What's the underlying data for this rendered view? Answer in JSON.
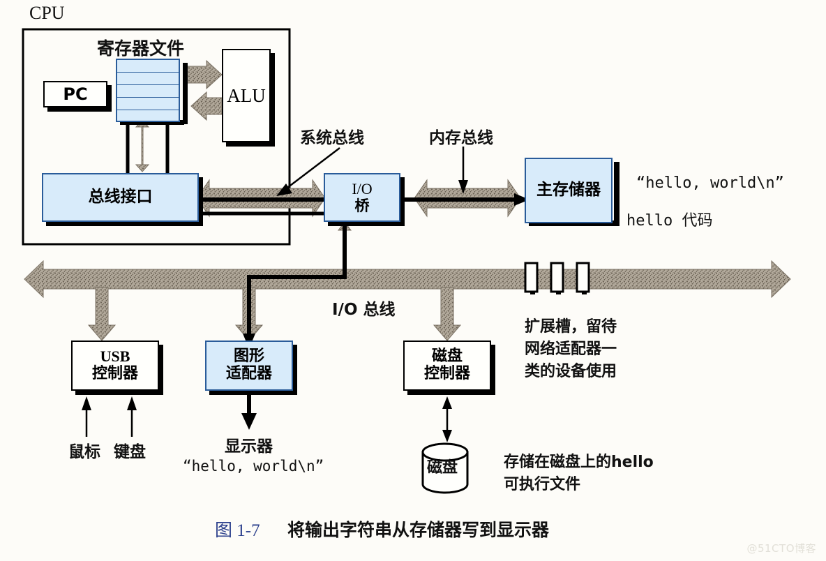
{
  "figure": {
    "cpu_label": "CPU",
    "caption_number": "图 1-7",
    "caption_text": "将输出字符串从存储器写到显示器",
    "watermark": "@51CTO博客"
  },
  "cpu": {
    "pc": "PC",
    "register_file_title": "寄存器文件",
    "alu": "ALU",
    "bus_interface": "总线接口"
  },
  "buses": {
    "system_bus": "系统总线",
    "memory_bus": "内存总线",
    "io_bus": "I/O 总线"
  },
  "bridge": {
    "line1": "I/O",
    "line2": "桥"
  },
  "memory": {
    "box": "主存储器",
    "contents_line1": "“hello, world\\n”",
    "contents_line2": "hello 代码"
  },
  "devices": [
    {
      "name": "usb-controller",
      "line1": "USB",
      "line2": "控制器",
      "style": "white"
    },
    {
      "name": "graphics-adapter",
      "line1": "图形",
      "line2": "适配器",
      "style": "blue"
    },
    {
      "name": "disk-controller",
      "line1": "磁盘",
      "line2": "控制器",
      "style": "white"
    }
  ],
  "peripherals": {
    "mouse": "鼠标",
    "keyboard": "键盘",
    "display": "显示器",
    "display_output": "“hello, world\\n”",
    "disk": "磁盘"
  },
  "notes": {
    "expansion_slots": [
      "扩展槽，留待",
      "网络适配器一",
      "类的设备使用"
    ],
    "disk_file": [
      "存储在磁盘上的hello",
      "可执行文件"
    ]
  },
  "colors": {
    "blue_fill": "#d8ebfa",
    "blue_stroke": "#2a5c9a",
    "bus_gray": "#a89f90",
    "caption_blue": "#2b3f8c"
  }
}
